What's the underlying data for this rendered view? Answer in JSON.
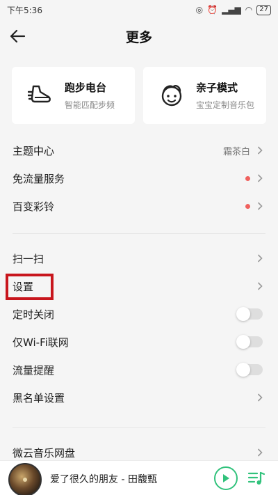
{
  "status_bar": {
    "time": "下午5:36",
    "battery": "27"
  },
  "header": {
    "title": "更多"
  },
  "cards": [
    {
      "title": "跑步电台",
      "subtitle": "智能匹配步频",
      "icon": "running-shoe-icon"
    },
    {
      "title": "亲子模式",
      "subtitle": "宝宝定制音乐包",
      "icon": "child-face-icon"
    }
  ],
  "menu_group1": {
    "theme": {
      "label": "主题中心",
      "value": "霜茶白"
    },
    "free_data": {
      "label": "免流量服务"
    },
    "ringtone": {
      "label": "百变彩铃"
    }
  },
  "menu_group2": {
    "scan": {
      "label": "扫一扫"
    },
    "settings": {
      "label": "设置"
    },
    "timer": {
      "label": "定时关闭",
      "enabled": false
    },
    "wifi_only": {
      "label": "仅Wi-Fi联网",
      "enabled": false
    },
    "data_alert": {
      "label": "流量提醒",
      "enabled": false
    },
    "blacklist": {
      "label": "黑名单设置"
    }
  },
  "menu_group3": {
    "cloud_disk": {
      "label": "微云音乐网盘"
    }
  },
  "player": {
    "song": "爱了很久的朋友 - 田馥甄"
  },
  "colors": {
    "accent": "#31c27c",
    "highlight": "#c8161d",
    "red_dot": "#f0615e"
  }
}
